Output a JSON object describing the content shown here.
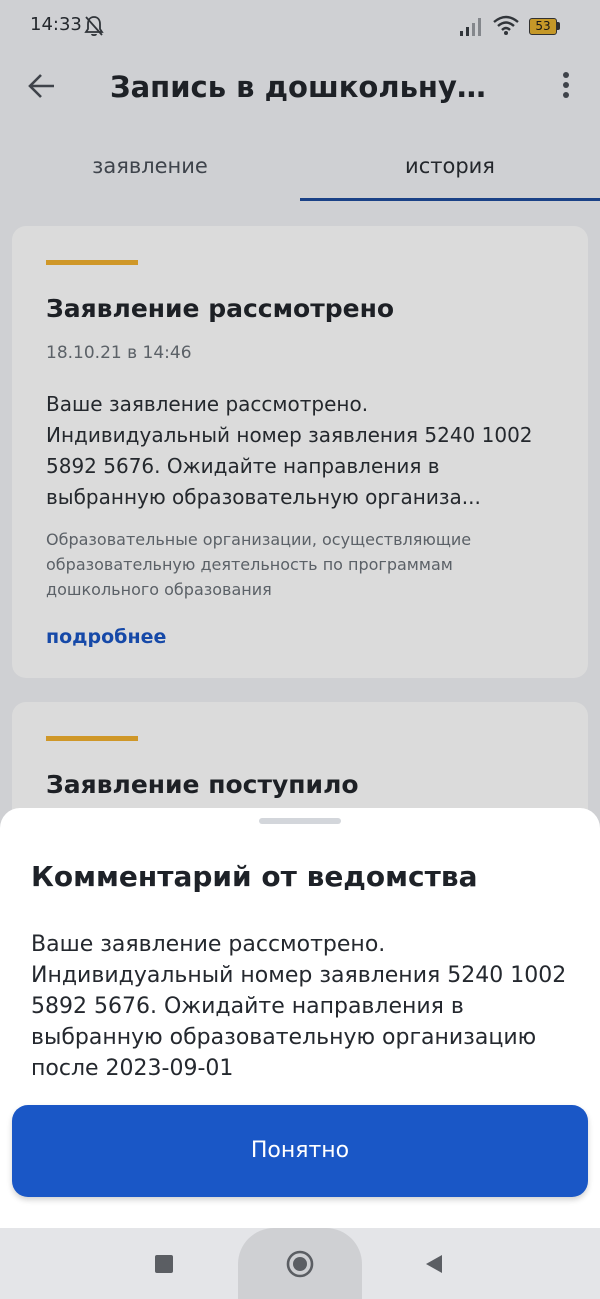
{
  "status_bar": {
    "time": "14:33",
    "battery": "53",
    "icons": [
      "bell-off-icon",
      "signal-icon",
      "wifi-icon",
      "battery-icon"
    ]
  },
  "app_bar": {
    "title": "Запись в дошкольную ор...",
    "back_icon": "arrow-left-icon",
    "menu_icon": "more-vertical-icon"
  },
  "tabs": [
    {
      "label": "заявление",
      "selected": false
    },
    {
      "label": "история",
      "selected": true
    }
  ],
  "colors": {
    "accent": "#f2b02f",
    "primary": "#1a57c6",
    "tab_indicator": "#1f4c9c"
  },
  "history": [
    {
      "title": "Заявление рассмотрено",
      "date": "18.10.21 в 14:46",
      "text": "Ваше заявление рассмотрено. Индивидуальный номер заявления 5240 1002 5892 5676. Ожидайте направления в выбранную образовательную организа...",
      "organization": "Образовательные организации, осуществляющие образовательную деятельность по программам дошкольного образования",
      "more_link": "подробнее"
    },
    {
      "title": "Заявление поступило"
    }
  ],
  "sheet": {
    "title": "Комментарий от ведомства",
    "text": "Ваше заявление рассмотрено. Индивидуальный номер заявления 5240 1002 5892 5676. Ожидайте направления в выбранную образовательную организацию после 2023-09-01",
    "button_label": "Понятно"
  },
  "nav_bar": {
    "icons": [
      "recents-icon",
      "home-icon",
      "back-triangle-icon"
    ]
  }
}
